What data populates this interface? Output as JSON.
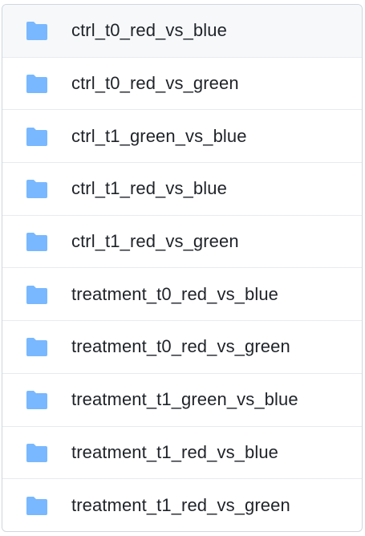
{
  "folder_icon_color": "#79b8ff",
  "items": [
    {
      "label": "ctrl_t0_red_vs_blue",
      "icon": "folder-icon"
    },
    {
      "label": "ctrl_t0_red_vs_green",
      "icon": "folder-icon"
    },
    {
      "label": "ctrl_t1_green_vs_blue",
      "icon": "folder-icon"
    },
    {
      "label": "ctrl_t1_red_vs_blue",
      "icon": "folder-icon"
    },
    {
      "label": "ctrl_t1_red_vs_green",
      "icon": "folder-icon"
    },
    {
      "label": "treatment_t0_red_vs_blue",
      "icon": "folder-icon"
    },
    {
      "label": "treatment_t0_red_vs_green",
      "icon": "folder-icon"
    },
    {
      "label": "treatment_t1_green_vs_blue",
      "icon": "folder-icon"
    },
    {
      "label": "treatment_t1_red_vs_blue",
      "icon": "folder-icon"
    },
    {
      "label": "treatment_t1_red_vs_green",
      "icon": "folder-icon"
    }
  ]
}
